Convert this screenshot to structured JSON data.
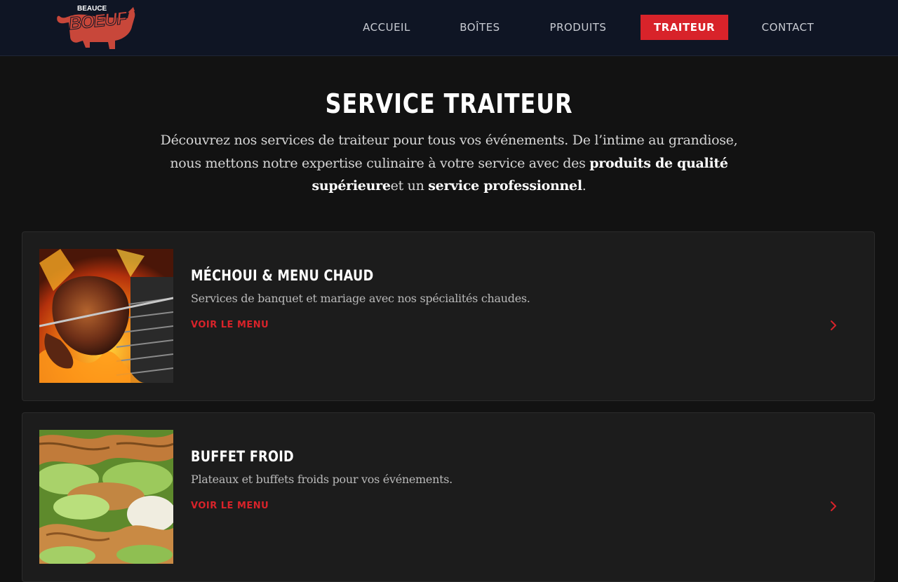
{
  "header": {
    "logo": {
      "brand_small": "BEAUCE",
      "brand_word": "BOEUF"
    },
    "nav": [
      {
        "label": "ACCUEIL",
        "active": false
      },
      {
        "label": "BOÎTES",
        "active": false
      },
      {
        "label": "PRODUITS",
        "active": false
      },
      {
        "label": "TRAITEUR",
        "active": true
      },
      {
        "label": "CONTACT",
        "active": false
      }
    ]
  },
  "hero": {
    "title": "SERVICE TRAITEUR",
    "line1": "Découvrez nos services de traiteur pour tous vos événements. De l’intime au grandiose,",
    "line2_plain": "nous mettons notre expertise culinaire à votre service avec des ",
    "line2_bold": "produits de qualité",
    "line3_bold1": "supérieure",
    "line3_plain": "et un ",
    "line3_bold2": "service professionnel",
    "line3_end": "."
  },
  "cards": [
    {
      "title": "MÉCHOUI & MENU CHAUD",
      "description": "Services de banquet et mariage avec nos spécialités chaudes.",
      "link": "VOIR LE MENU",
      "image": "grilled-chicken-photo"
    },
    {
      "title": "BUFFET FROID",
      "description": "Plateaux et buffets froids pour vos événements.",
      "link": "VOIR LE MENU",
      "image": "croissant-sandwich-photo"
    }
  ],
  "colors": {
    "accent": "#d8232a",
    "header_bg": "#0f1524",
    "page_bg": "#121212",
    "card_bg": "#1c1c1c"
  },
  "icons": {
    "card_arrow": "chevron-right-icon"
  }
}
